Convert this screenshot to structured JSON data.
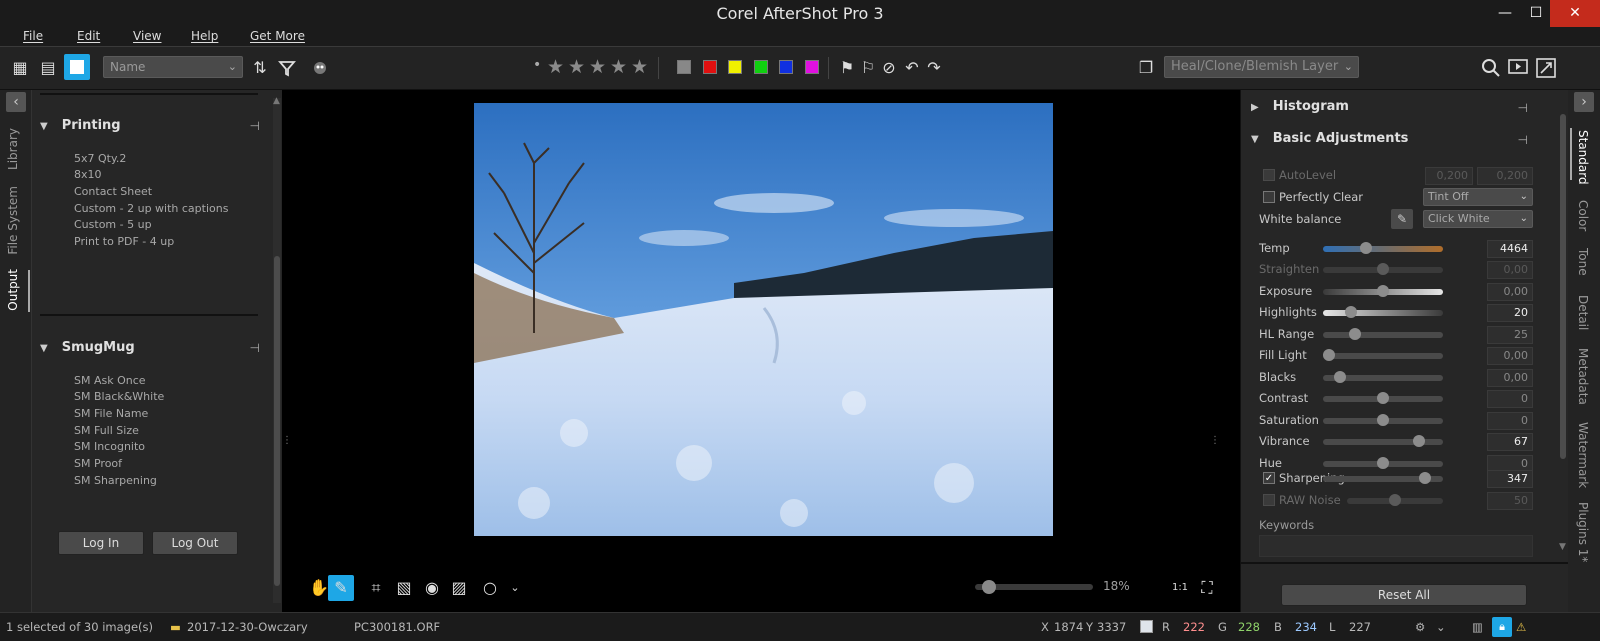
{
  "window": {
    "title": "Corel AfterShot Pro 3",
    "minimize": "—",
    "maximize": "☐",
    "close": "✕"
  },
  "menu": [
    "File",
    "Edit",
    "View",
    "Help",
    "Get More"
  ],
  "toolbar": {
    "sort_select": "Name",
    "layer_select": "Heal/Clone/Blemish Layer",
    "rating_dot": "•",
    "color_labels": [
      "#888888",
      "#e01010",
      "#f0f000",
      "#10d010",
      "#1030e0",
      "#e010e0"
    ]
  },
  "left_tabs": [
    "Library",
    "File System",
    "Output"
  ],
  "printing": {
    "title": "Printing",
    "items": [
      "5x7 Qty.2",
      "8x10",
      "Contact Sheet",
      "Custom - 2 up with captions",
      "Custom - 5 up",
      "Print to PDF - 4 up"
    ]
  },
  "smugmug": {
    "title": "SmugMug",
    "items": [
      "SM Ask Once",
      "SM Black&White",
      "SM File Name",
      "SM Full Size",
      "SM Incognito",
      "SM Proof",
      "SM Sharpening"
    ],
    "login": "Log In",
    "logout": "Log Out"
  },
  "zoom": {
    "label": "18%",
    "level": 0.18
  },
  "right_panel": {
    "histogram_title": "Histogram",
    "basic_title": "Basic Adjustments",
    "autolevel": {
      "label": "AutoLevel",
      "v1": "0,200",
      "v2": "0,200"
    },
    "perfectly_clear": {
      "label": "Perfectly Clear",
      "select": "Tint Off"
    },
    "white_balance": {
      "label": "White balance",
      "select": "Click White"
    },
    "sliders": [
      {
        "label": "Temp",
        "value": "4464",
        "pos": 0.36
      },
      {
        "label": "Straighten",
        "value": "0,00",
        "pos": 0.5
      },
      {
        "label": "Exposure",
        "value": "0,00",
        "pos": 0.5
      },
      {
        "label": "Highlights",
        "value": "20",
        "pos": 0.23
      },
      {
        "label": "HL Range",
        "value": "25",
        "pos": 0.27
      },
      {
        "label": "Fill Light",
        "value": "0,00",
        "pos": 0.05
      },
      {
        "label": "Blacks",
        "value": "0,00",
        "pos": 0.14
      },
      {
        "label": "Contrast",
        "value": "0",
        "pos": 0.5
      },
      {
        "label": "Saturation",
        "value": "0",
        "pos": 0.5
      },
      {
        "label": "Vibrance",
        "value": "67",
        "pos": 0.8
      },
      {
        "label": "Hue",
        "value": "0",
        "pos": 0.5
      }
    ],
    "sharpening": {
      "label": "Sharpening",
      "value": "347",
      "pos": 0.85,
      "check": "✓"
    },
    "raw_noise": {
      "label": "RAW Noise",
      "value": "50",
      "pos": 0.5
    },
    "keywords_label": "Keywords",
    "reset_all": "Reset All"
  },
  "right_tabs": [
    "Standard",
    "Color",
    "Tone",
    "Detail",
    "Metadata",
    "Watermark",
    "Plugins 1*"
  ],
  "status": {
    "selection": "1 selected of 30 image(s)",
    "folder": "2017-12-30-Owczary",
    "filename": "PC300181.ORF",
    "x_label": "X",
    "x": "1874",
    "y_label": "Y",
    "y": "3337",
    "r_label": "R",
    "r": "222",
    "g_label": "G",
    "g": "228",
    "b_label": "B",
    "b": "234",
    "l_label": "L",
    "l": "227"
  }
}
